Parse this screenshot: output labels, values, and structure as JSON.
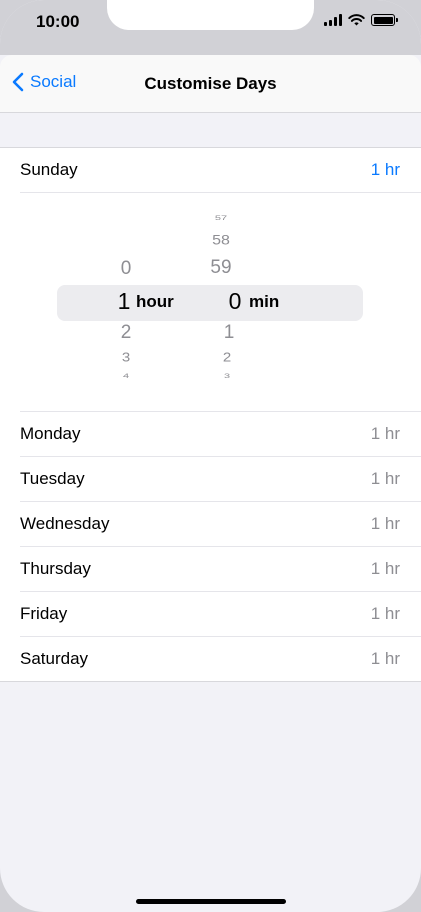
{
  "status": {
    "time": "10:00"
  },
  "nav": {
    "back_label": "Social",
    "title": "Customise Days"
  },
  "sunday": {
    "label": "Sunday",
    "value": "1 hr"
  },
  "picker": {
    "hours": {
      "above": [
        "0"
      ],
      "selected": "1",
      "below": [
        "2",
        "3",
        "4"
      ],
      "unit": "hour"
    },
    "minutes": {
      "above": [
        "57",
        "58",
        "59"
      ],
      "selected": "0",
      "below": [
        "1",
        "2",
        "3"
      ],
      "unit": "min"
    }
  },
  "days": [
    {
      "label": "Monday",
      "value": "1 hr"
    },
    {
      "label": "Tuesday",
      "value": "1 hr"
    },
    {
      "label": "Wednesday",
      "value": "1 hr"
    },
    {
      "label": "Thursday",
      "value": "1 hr"
    },
    {
      "label": "Friday",
      "value": "1 hr"
    },
    {
      "label": "Saturday",
      "value": "1 hr"
    }
  ],
  "colors": {
    "accent": "#0a7aff",
    "secondary_text": "#8e8e93",
    "background": "#f2f2f7"
  },
  "icons": {
    "back": "chevron-left-icon",
    "signal": "cellular-signal-icon",
    "wifi": "wifi-icon",
    "battery": "battery-icon"
  }
}
